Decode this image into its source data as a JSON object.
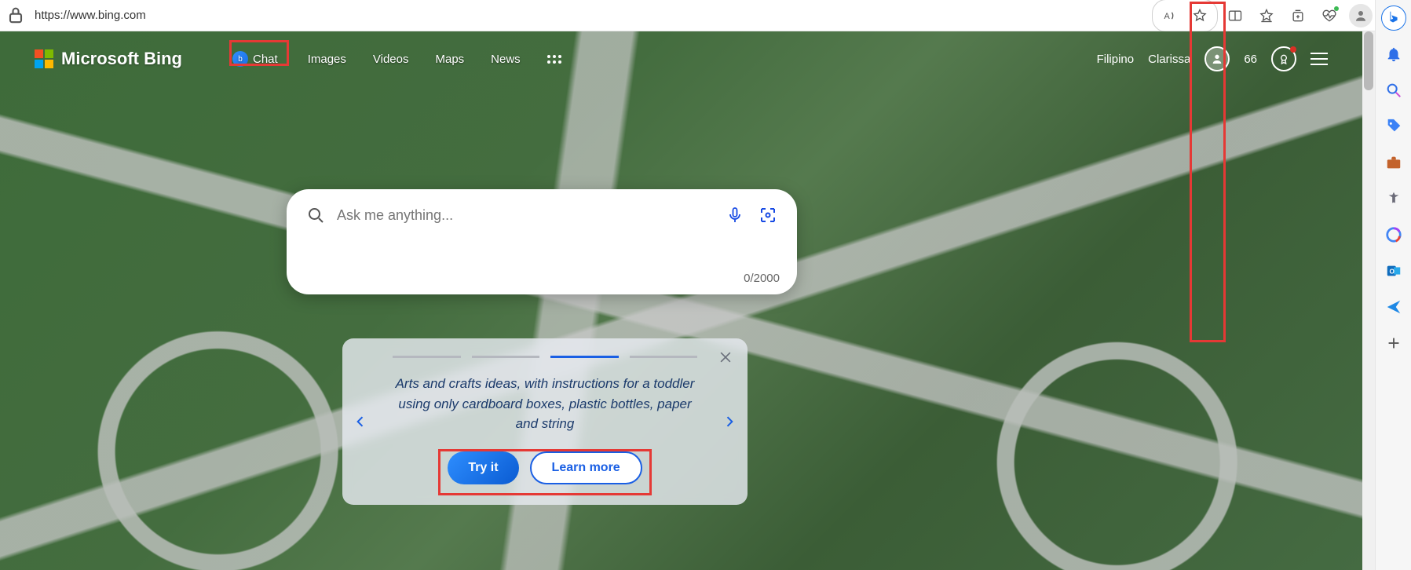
{
  "browser": {
    "url": "https://www.bing.com",
    "toolbar_icons": [
      "read-aloud",
      "favorite",
      "split-screen",
      "favorites-list",
      "collections",
      "health",
      "profile",
      "more"
    ]
  },
  "edge_sidebar": {
    "items": [
      "bing",
      "bell",
      "search",
      "tag",
      "briefcase",
      "games",
      "office",
      "outlook",
      "send",
      "add"
    ]
  },
  "header": {
    "logo_text": "Microsoft Bing",
    "nav": {
      "chat": "Chat",
      "images": "Images",
      "videos": "Videos",
      "maps": "Maps",
      "news": "News"
    },
    "lang": "Filipino",
    "user": "Clarissa",
    "rewards_points": "66"
  },
  "search": {
    "placeholder": "Ask me anything...",
    "counter": "0/2000"
  },
  "promo": {
    "text": "Arts and crafts ideas, with instructions for a toddler using only cardboard boxes, plastic bottles, paper and string",
    "try_it": "Try it",
    "learn_more": "Learn more",
    "active_index": 2,
    "total": 4
  }
}
